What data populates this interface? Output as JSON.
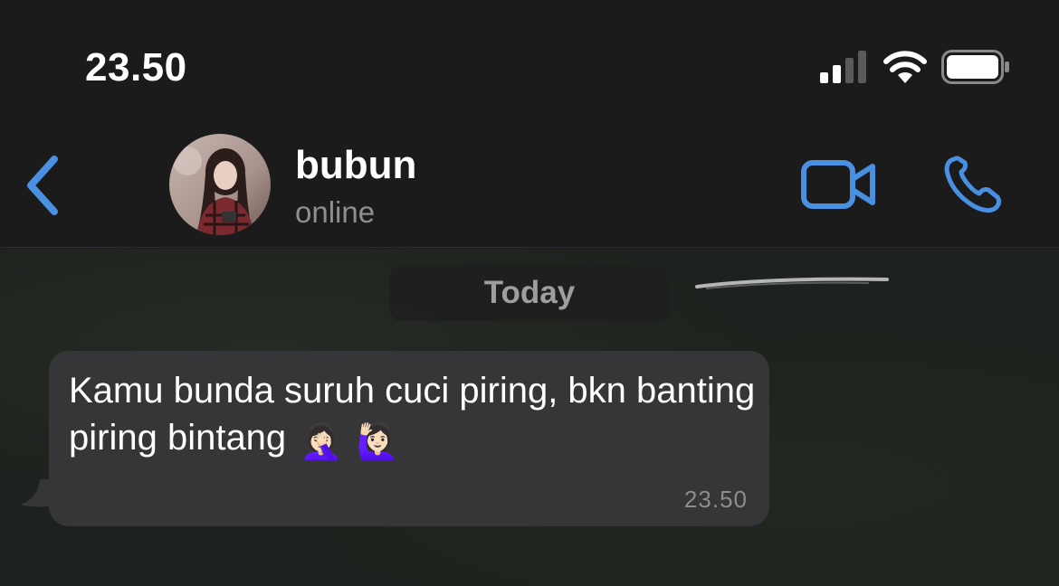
{
  "status_bar": {
    "time": "23.50",
    "signal_icon": "cellular-signal-icon",
    "wifi_icon": "wifi-icon",
    "battery_icon": "battery-icon"
  },
  "header": {
    "back_icon": "chevron-left-icon",
    "contact_name": "bubun",
    "contact_status": "online",
    "video_icon": "video-camera-icon",
    "call_icon": "phone-icon",
    "accent_color": "#4a90e2"
  },
  "chat": {
    "date_label": "Today",
    "messages": [
      {
        "text": "Kamu bunda suruh cuci piring, bkn banting piring bintang",
        "emojis": [
          "🤦🏻‍♀️",
          "🙋🏻‍♀️"
        ],
        "time": "23.50",
        "direction": "incoming"
      }
    ]
  }
}
